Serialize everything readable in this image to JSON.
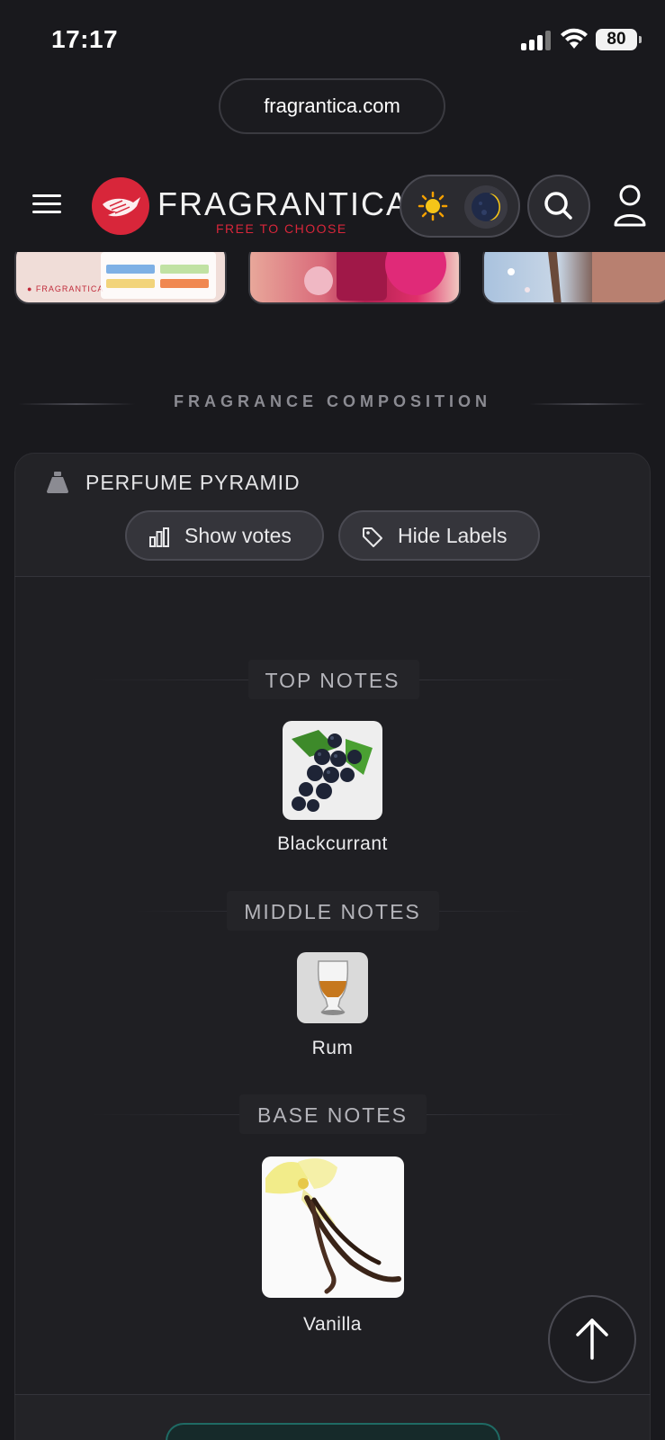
{
  "status_bar": {
    "time": "17:17",
    "battery": "80"
  },
  "browser": {
    "url": "fragrantica.com"
  },
  "header": {
    "brand": "FRAGRANTICA",
    "tagline": "FREE TO CHOOSE",
    "brand_color": "#d8263a",
    "icons": [
      "menu-icon",
      "sun-icon",
      "moon-icon",
      "search-icon",
      "user-icon"
    ]
  },
  "section": {
    "title": "FRAGRANCE COMPOSITION"
  },
  "pyramid": {
    "title": "PERFUME PYRAMID",
    "show_votes_label": "Show votes",
    "hide_labels_label": "Hide Labels",
    "top": {
      "heading": "TOP NOTES",
      "note": "Blackcurrant"
    },
    "middle": {
      "heading": "MIDDLE NOTES",
      "note": "Rum"
    },
    "base": {
      "heading": "BASE NOTES",
      "note": "Vanilla"
    }
  },
  "accent_color": "#1f6a64"
}
